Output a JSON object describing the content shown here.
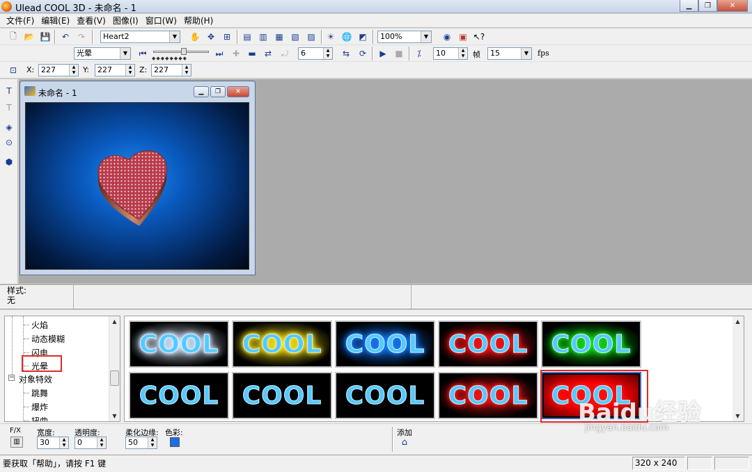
{
  "window": {
    "title": "Ulead COOL 3D - 未命名 - 1"
  },
  "menu": [
    "文件(F)",
    "编辑(E)",
    "查看(V)",
    "图像(I)",
    "窗口(W)",
    "帮助(H)"
  ],
  "toolbar1": {
    "object_select": "Heart2",
    "zoom_select": "100%"
  },
  "toolbar2": {
    "effect_select": "光晕",
    "frame_value": "6",
    "frame_count": "10",
    "frame_label": "帧",
    "fps_value": "15",
    "fps_label": "fps"
  },
  "toolbar3": {
    "x_label": "X:",
    "x_value": "227",
    "y_label": "Y:",
    "y_value": "227",
    "z_label": "Z:",
    "z_value": "227"
  },
  "doc_window": {
    "title": "未命名 - 1"
  },
  "style_bar": {
    "label": "样式:",
    "value": "无"
  },
  "tree": {
    "items": [
      {
        "label": "火焰",
        "selected": false
      },
      {
        "label": "动态模糊",
        "selected": false
      },
      {
        "label": "闪电",
        "selected": false
      },
      {
        "label": "光晕",
        "selected": true
      },
      {
        "label": "对象特效",
        "selected": false,
        "expanded": true
      },
      {
        "label": "跳舞",
        "selected": false
      },
      {
        "label": "爆炸",
        "selected": false
      },
      {
        "label": "扭曲",
        "selected": false
      }
    ]
  },
  "gallery": {
    "thumbnails": [
      {
        "text": "COOL",
        "glow": "#d8e8ff",
        "bg": "#000000"
      },
      {
        "text": "COOL",
        "glow": "#ffe81a",
        "bg": "#000000"
      },
      {
        "text": "COOL",
        "glow": "#1a7cff",
        "bg": "#000000"
      },
      {
        "text": "COOL",
        "glow": "#ff1a1a",
        "bg": "#000000"
      },
      {
        "text": "COOL",
        "glow": "#19e019",
        "bg": "#000000"
      },
      {
        "text": "COOL",
        "glow": "#000000",
        "bg": "#000000"
      },
      {
        "text": "COOL",
        "glow": "#000000",
        "bg": "#000000"
      },
      {
        "text": "COOL",
        "glow": "#000000",
        "bg": "#000000"
      },
      {
        "text": "COOL",
        "glow": "#ff1a1a",
        "bg": "#000000"
      },
      {
        "text": "COOL",
        "glow": "#ff1a1a",
        "bg": "#ff0000",
        "selected": true
      }
    ]
  },
  "properties": {
    "fx_label": "F/X",
    "width_label": "宽度:",
    "width_value": "30",
    "opacity_label": "透明度:",
    "opacity_value": "0",
    "soft_edge_label": "柔化边缘:",
    "soft_edge_value": "50",
    "color_label": "色彩:",
    "color_value": "#1a6ee8",
    "add_label": "添加"
  },
  "status": {
    "message": "要获取「帮助」，请按 F1 键",
    "size": "320 x 240"
  },
  "watermark": {
    "brand": "Baidu经验",
    "url": "jingyan.baidu.com"
  }
}
